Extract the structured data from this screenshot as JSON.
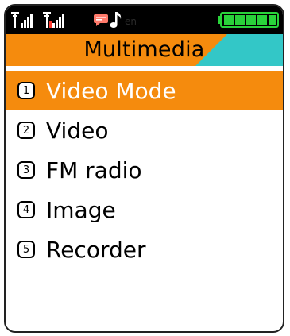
{
  "status": {
    "language": "en",
    "icons": [
      "signal-sim1-icon",
      "signal-sim2-icon",
      "message-icon",
      "music-note-icon",
      "battery-full-icon"
    ]
  },
  "title": "Multimedia",
  "menu": {
    "items": [
      {
        "number": "1",
        "label": "Video Mode",
        "selected": true
      },
      {
        "number": "2",
        "label": "Video",
        "selected": false
      },
      {
        "number": "3",
        "label": "FM radio",
        "selected": false
      },
      {
        "number": "4",
        "label": "Image",
        "selected": false
      },
      {
        "number": "5",
        "label": "Recorder",
        "selected": false
      }
    ]
  },
  "colors": {
    "accent": "#f58b0d",
    "title_accent": "#33c7c7",
    "battery": "#29d43a",
    "status_bg": "#000000"
  }
}
